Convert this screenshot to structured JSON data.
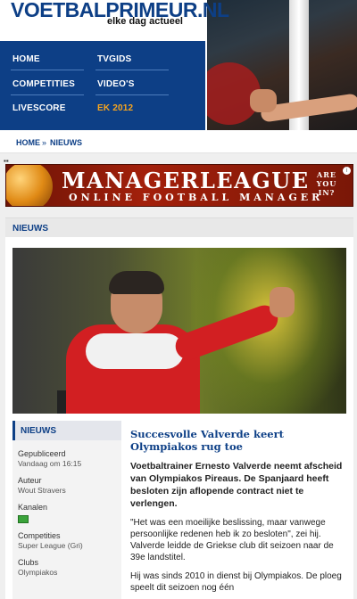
{
  "header": {
    "logo": "VOETBALPRIMEUR.NL",
    "tagline": "elke dag actueel"
  },
  "nav": {
    "home": "HOME",
    "tvgids": "TVGIDS",
    "competities": "COMPETITIES",
    "videos": "VIDEO'S",
    "livescore": "LIVESCORE",
    "ek": "EK 2012",
    "highlight_color": "#f7a51e"
  },
  "breadcrumb": {
    "home": "HOME",
    "separator": "»",
    "current": "NIEUWS"
  },
  "banner": {
    "title": "MANAGERLEAGUE",
    "subtitle": "ONLINE FOOTBALL MANAGER",
    "cta_line1": "ARE",
    "cta_line2": "YOU",
    "cta_line3": "IN?",
    "info": "i"
  },
  "section": {
    "title": "NIEUWS"
  },
  "infobox": {
    "title": "NIEUWS",
    "published_label": "Gepubliceerd",
    "published_value": "Vandaag om 16:15",
    "author_label": "Auteur",
    "author_value": "Wout Stravers",
    "channels_label": "Kanalen",
    "channel_icon": "tv-icon",
    "competitions_label": "Competities",
    "competitions_value": "Super League (Gri)",
    "clubs_label": "Clubs",
    "clubs_value": "Olympiakos"
  },
  "article": {
    "title": "Succesvolle Valverde keert Olympiakos rug toe",
    "lead": "Voetbaltrainer Ernesto Valverde neemt afscheid van Olympiakos Pireaus. De Spanjaard heeft besloten zijn aflopende contract niet te verlengen.",
    "p1": "\"Het was een moeilijke beslissing, maar vanwege persoonlijke redenen heb ik zo besloten\", zei hij. Valverde leidde de Griekse club dit seizoen naar de 39e landstitel.",
    "p2": "Hij was sinds 2010 in dienst bij Olympiakos. De ploeg speelt dit seizoen nog één"
  },
  "colors": {
    "brand_blue": "#0d3f86",
    "banner_red": "#a3200b"
  }
}
